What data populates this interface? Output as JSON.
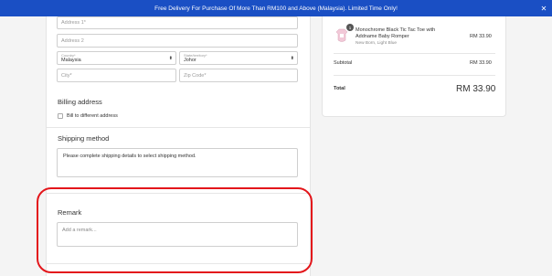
{
  "banner": {
    "text": "Free Delivery For Purchase Of More Than RM100 and Above (Malaysia). Limited Time Only!",
    "close_glyph": "✕"
  },
  "address_form": {
    "address1_placeholder": "Address 1*",
    "address2_placeholder": "Address 2",
    "country_label": "Country*",
    "country_value": "Malaysia",
    "state_label": "State/territory*",
    "state_value": "Johor",
    "city_placeholder": "City*",
    "zip_placeholder": "Zip Code*"
  },
  "billing": {
    "title": "Billing address",
    "checkbox_label": "Bill to different address"
  },
  "shipping": {
    "title": "Shipping method",
    "message": "Please complete shipping details to select shipping method."
  },
  "remark": {
    "title": "Remark",
    "placeholder": "Add a remark..."
  },
  "summary": {
    "item": {
      "qty": "1",
      "name": "Monochrome Black Tic Tac Toe with Addname Baby Romper",
      "variant": "New Born, Light Blue",
      "price": "RM 33.90"
    },
    "subtotal_label": "Subtotal",
    "subtotal_value": "RM 33.90",
    "total_label": "Total",
    "total_value": "RM 33.90"
  },
  "colors": {
    "banner_bg": "#1a4fc4",
    "highlight_border": "#e3161b"
  },
  "icons": {
    "close": "close-icon",
    "dropdown": "chevron-updown-icon",
    "product": "romper-thumbnail-icon"
  }
}
